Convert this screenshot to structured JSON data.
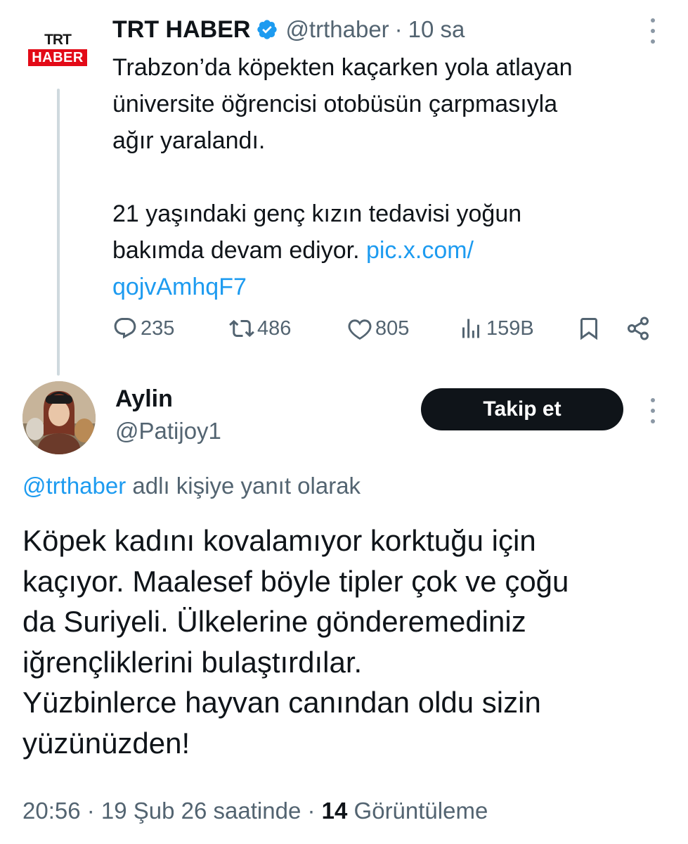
{
  "parent_tweet": {
    "logo": {
      "top": "TRT",
      "bottom": "HABER"
    },
    "author_name": "TRT HABER",
    "verified": true,
    "handle": "@trthaber",
    "separator": "·",
    "time": "10 sa",
    "text_lines_1": [
      "Trabzon’da köpekten kaçarken yola atlayan",
      "üniversite öğrencisi otobüsün çarpmasıyla",
      "ağır yaralandı."
    ],
    "text_line_4": "21 yaşındaki genç kızın tedavisi yoğun",
    "text_line_5_prefix": "bakımda devam ediyor. ",
    "link_part1": "pic.x.com/",
    "link_part2": "qojvAmhqF7",
    "actions": {
      "replies": "235",
      "reposts": "486",
      "likes": "805",
      "views": "159B"
    }
  },
  "reply_tweet": {
    "author_name": "Aylin",
    "handle": "@Patijoy1",
    "follow_label": "Takip et",
    "reply_mention": "@trthaber",
    "reply_suffix": " adlı kişiye yanıt olarak",
    "text_lines": [
      "Köpek kadını kovalamıyor korktuğu için",
      "kaçıyor. Maalesef böyle tipler çok ve çoğu",
      "da Suriyeli. Ülkelerine gönderemediniz",
      "iğrençliklerini bulaştırdılar.",
      "Yüzbinlerce hayvan canından oldu sizin",
      "yüzünüzden!"
    ],
    "time": "20:56",
    "date": "19 Şub 26 saatinde",
    "views_count": "14",
    "views_label": "Görüntüleme"
  },
  "colors": {
    "text": "#0f1419",
    "secondary": "#536471",
    "link": "#1d9bf0",
    "brand_red": "#e30a17",
    "verified": "#1d9bf0",
    "follow_bg": "#0f1419"
  }
}
